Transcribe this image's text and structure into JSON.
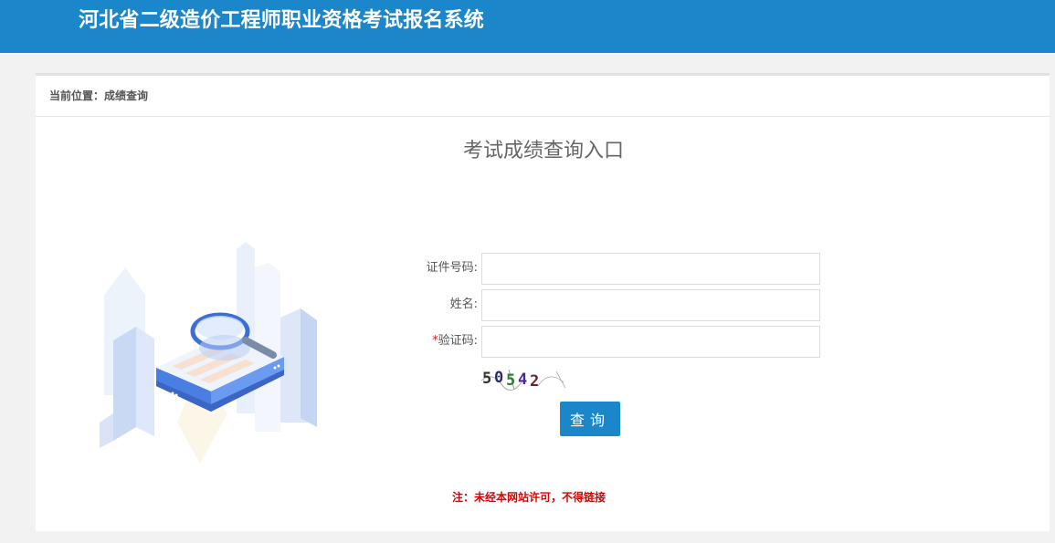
{
  "header": {
    "title": "河北省二级造价工程师职业资格考试报名系统"
  },
  "breadcrumb": {
    "text": "当前位置：成绩查询"
  },
  "main": {
    "heading": "考试成绩查询入口"
  },
  "form": {
    "id_label": "证件号码:",
    "id_value": "",
    "name_label": "姓名:",
    "name_value": "",
    "captcha_required_mark": "*",
    "captcha_label": "验证码:",
    "captcha_value": "",
    "captcha_code": "50542",
    "submit_label": "查询"
  },
  "notice": {
    "text": "注：未经本网站许可，不得链接"
  },
  "colors": {
    "header_bg": "#1b86c9",
    "button_bg": "#1b86c9",
    "notice": "#e00000"
  },
  "icons": {
    "illustration": "magnifier-over-document-illustration"
  }
}
